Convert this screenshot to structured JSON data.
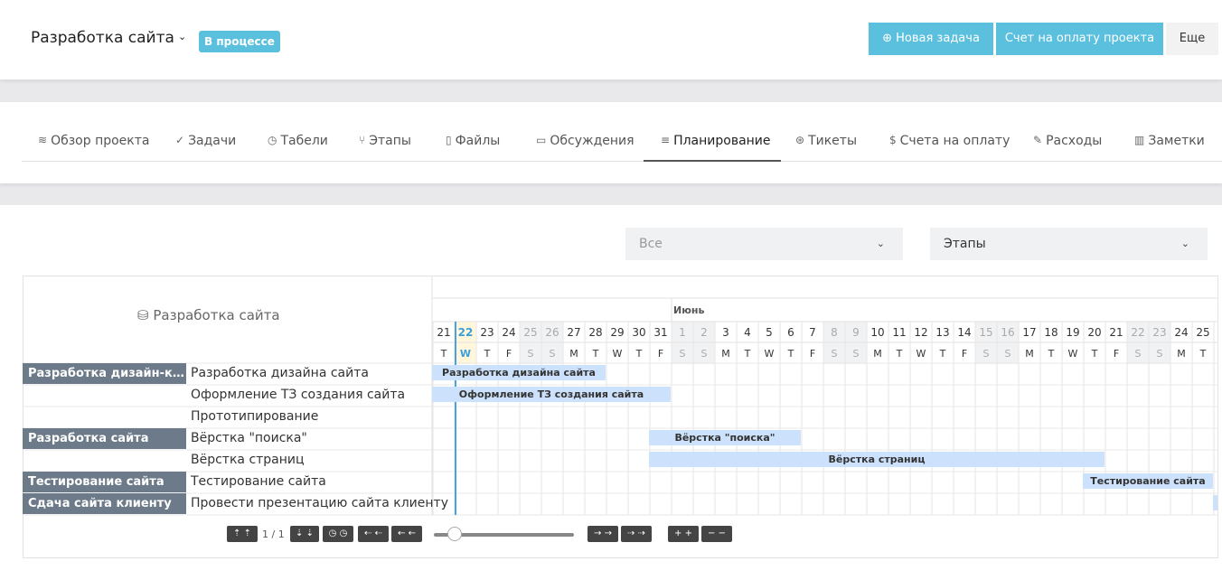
{
  "header": {
    "project_title": "Разработка сайта",
    "status_badge": "В процессе",
    "new_task_button": "Новая задача",
    "invoice_button": "Счет на оплату проекта",
    "more_button": "Еще"
  },
  "tabs": [
    {
      "label": "Обзор проекта",
      "icon": "layers-icon"
    },
    {
      "label": "Задачи",
      "icon": "check-circle-icon"
    },
    {
      "label": "Табели",
      "icon": "clock-icon"
    },
    {
      "label": "Этапы",
      "icon": "branch-icon"
    },
    {
      "label": "Файлы",
      "icon": "file-icon"
    },
    {
      "label": "Обсуждения",
      "icon": "comment-icon"
    },
    {
      "label": "Планирование",
      "icon": "align-left-icon",
      "active": true
    },
    {
      "label": "Тикеты",
      "icon": "lifebuoy-icon"
    },
    {
      "label": "Счета на оплату",
      "icon": "dollar-icon"
    },
    {
      "label": "Расходы",
      "icon": "edit-icon"
    },
    {
      "label": "Заметки",
      "icon": "book-icon"
    }
  ],
  "filters": {
    "member_select": "Все",
    "group_select": "Этапы"
  },
  "gantt": {
    "title": "Разработка сайта",
    "month_label": "Июнь",
    "today_index": 1,
    "days": [
      {
        "d": "21",
        "w": "T"
      },
      {
        "d": "22",
        "w": "W"
      },
      {
        "d": "23",
        "w": "T"
      },
      {
        "d": "24",
        "w": "F"
      },
      {
        "d": "25",
        "w": "S"
      },
      {
        "d": "26",
        "w": "S"
      },
      {
        "d": "27",
        "w": "M"
      },
      {
        "d": "28",
        "w": "T"
      },
      {
        "d": "29",
        "w": "W"
      },
      {
        "d": "30",
        "w": "T"
      },
      {
        "d": "31",
        "w": "F"
      },
      {
        "d": "1",
        "w": "S"
      },
      {
        "d": "2",
        "w": "S"
      },
      {
        "d": "3",
        "w": "M"
      },
      {
        "d": "4",
        "w": "T"
      },
      {
        "d": "5",
        "w": "W"
      },
      {
        "d": "6",
        "w": "T"
      },
      {
        "d": "7",
        "w": "F"
      },
      {
        "d": "8",
        "w": "S"
      },
      {
        "d": "9",
        "w": "S"
      },
      {
        "d": "10",
        "w": "M"
      },
      {
        "d": "11",
        "w": "T"
      },
      {
        "d": "12",
        "w": "W"
      },
      {
        "d": "13",
        "w": "T"
      },
      {
        "d": "14",
        "w": "F"
      },
      {
        "d": "15",
        "w": "S"
      },
      {
        "d": "16",
        "w": "S"
      },
      {
        "d": "17",
        "w": "M"
      },
      {
        "d": "18",
        "w": "T"
      },
      {
        "d": "19",
        "w": "W"
      },
      {
        "d": "20",
        "w": "T"
      },
      {
        "d": "21",
        "w": "F"
      },
      {
        "d": "22",
        "w": "S"
      },
      {
        "d": "23",
        "w": "S"
      },
      {
        "d": "24",
        "w": "M"
      },
      {
        "d": "25",
        "w": "T"
      }
    ],
    "rows": [
      {
        "stage": "Разработка дизайн-конце...",
        "task": "Разработка дизайна сайта",
        "bar_label": "Разработка дизайна сайта",
        "start": 0,
        "end": 8
      },
      {
        "stage": "",
        "task": "Оформление ТЗ создания сайта",
        "bar_label": "Оформление ТЗ создания сайта",
        "start": 0,
        "end": 11
      },
      {
        "stage": "",
        "task": "Прототипирование",
        "bar_label": "",
        "start": null,
        "end": null
      },
      {
        "stage": "Разработка сайта",
        "task": "Вёрстка \"поиска\"",
        "bar_label": "Вёрстка \"поиска\"",
        "start": 10,
        "end": 17
      },
      {
        "stage": "",
        "task": "Вёрстка страниц",
        "bar_label": "Вёрстка страниц",
        "start": 10,
        "end": 31
      },
      {
        "stage": "Тестирование сайта",
        "task": "Тестирование сайта",
        "bar_label": "Тестирование сайта",
        "start": 30,
        "end": 36
      },
      {
        "stage": "Сдача сайта клиенту",
        "task": "Провести презентацию сайта клиенту",
        "bar_label": "",
        "start": 36,
        "end": 37
      }
    ],
    "pages": "1 / 1"
  }
}
